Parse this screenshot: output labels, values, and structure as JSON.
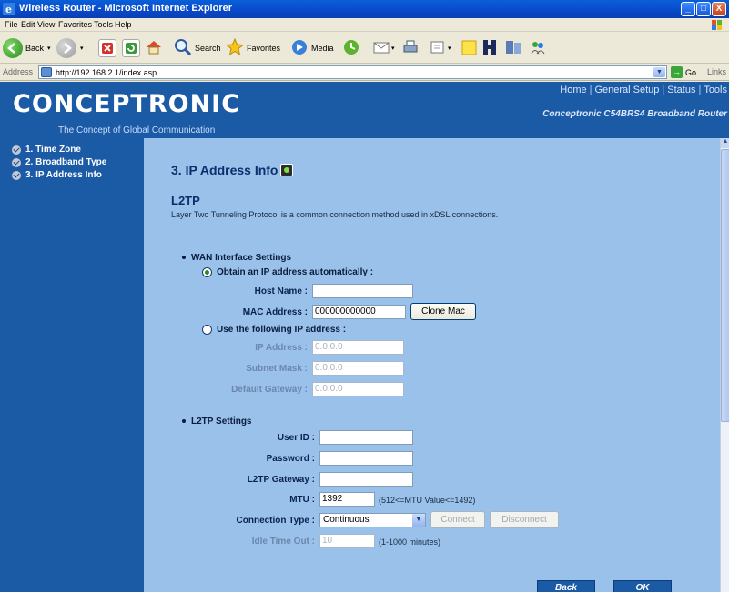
{
  "window": {
    "title": "Wireless Router - Microsoft Internet Explorer",
    "min_label": "_",
    "max_label": "□",
    "close_label": "X"
  },
  "menu": [
    "File",
    "Edit",
    "View",
    "Favorites",
    "Tools",
    "Help"
  ],
  "toolbar": {
    "back_label": "Back",
    "search_label": "Search",
    "favorites_label": "Favorites",
    "media_label": "Media"
  },
  "address_bar": {
    "label": "Address",
    "url": "http://192.168.2.1/index.asp",
    "go_label": "Go",
    "links_label": "Links"
  },
  "header": {
    "logo": "CONCEPTRONIC",
    "tagline": "The Concept of Global Communication",
    "nav": [
      "Home",
      "General Setup",
      "Status",
      "Tools"
    ],
    "model": "Conceptronic C54BRS4 Broadband Router"
  },
  "sidebar": {
    "steps": [
      {
        "label": "1. Time Zone"
      },
      {
        "label": "2. Broadband Type"
      },
      {
        "label": "3. IP Address Info"
      }
    ]
  },
  "content": {
    "page_title": "3. IP Address Info",
    "section_title": "L2TP",
    "description": "Layer Two Tunneling Protocol is a common connection method used in xDSL connections.",
    "wan": {
      "heading": "WAN Interface Settings",
      "auto_label": "Obtain an IP address automatically :",
      "auto_selected": true,
      "host_name_label": "Host Name :",
      "host_name_value": "",
      "mac_label": "MAC Address :",
      "mac_value": "000000000000",
      "clone_mac_label": "Clone Mac",
      "static_label": "Use the following IP address :",
      "ip_label": "IP Address :",
      "ip_value": "0.0.0.0",
      "mask_label": "Subnet Mask :",
      "mask_value": "0.0.0.0",
      "gateway_label": "Default Gateway :",
      "gateway_value": "0.0.0.0"
    },
    "l2tp": {
      "heading": "L2TP Settings",
      "user_label": "User ID :",
      "user_value": "",
      "password_label": "Password :",
      "password_value": "",
      "l2tp_gateway_label": "L2TP Gateway :",
      "l2tp_gateway_value": "",
      "mtu_label": "MTU :",
      "mtu_value": "1392",
      "mtu_hint": "(512<=MTU Value<=1492)",
      "conn_type_label": "Connection Type :",
      "conn_type_value": "Continuous",
      "connect_label": "Connect",
      "disconnect_label": "Disconnect",
      "idle_label": "Idle Time Out :",
      "idle_value": "10",
      "idle_hint": "(1-1000 minutes)"
    },
    "back_label": "Back",
    "ok_label": "OK"
  },
  "colors": {
    "page_blue": "#1b5aa5",
    "content_bg": "#99c1ea",
    "heading_navy": "#0a2f6e"
  }
}
